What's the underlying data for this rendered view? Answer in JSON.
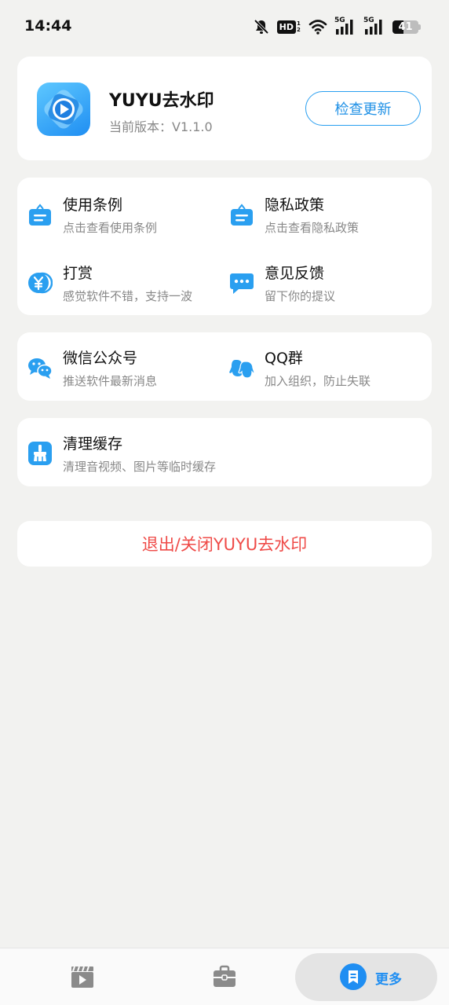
{
  "status_bar": {
    "time": "14:44",
    "hd_label": "HD",
    "hd_sub": "1 2",
    "network_5g_1": "5G",
    "network_5g_2": "5G",
    "battery": "41",
    "battery_level": 0.41,
    "icons": [
      "bell-off-icon",
      "hd-icon",
      "wifi-icon",
      "signal-5g-icon",
      "signal-5g-icon",
      "battery-icon"
    ]
  },
  "app_info": {
    "name": "YUYU去水印",
    "version": "当前版本：V1.1.0",
    "update_button": "检查更新"
  },
  "menu": [
    {
      "title": "使用条例",
      "subtitle": "点击查看使用条例",
      "icon": "document-bag-icon"
    },
    {
      "title": "隐私政策",
      "subtitle": "点击查看隐私政策",
      "icon": "document-bag-icon"
    },
    {
      "title": "打赏",
      "subtitle": "感觉软件不错，支持一波",
      "icon": "yuan-coin-icon"
    },
    {
      "title": "意见反馈",
      "subtitle": "留下你的提议",
      "icon": "chat-bubble-icon"
    }
  ],
  "social": [
    {
      "title": "微信公众号",
      "subtitle": "推送软件最新消息",
      "icon": "wechat-icon"
    },
    {
      "title": "QQ群",
      "subtitle": "加入组织，防止失联",
      "icon": "qq-group-icon"
    }
  ],
  "cache": {
    "title": "清理缓存",
    "subtitle": "清理音视频、图片等临时缓存",
    "icon": "broom-icon"
  },
  "exit_label": "退出/关闭YUYU去水印",
  "bottom_nav": {
    "items": [
      {
        "icon": "video-clapper-icon",
        "active": false
      },
      {
        "icon": "toolbox-icon",
        "active": false
      },
      {
        "icon": "more-document-icon",
        "label": "更多",
        "active": true
      }
    ]
  },
  "colors": {
    "accent": "#1f8ef2",
    "exit_text": "#ef4a47",
    "background": "#f2f2f0",
    "icon_blue": "#2a9ff0"
  }
}
